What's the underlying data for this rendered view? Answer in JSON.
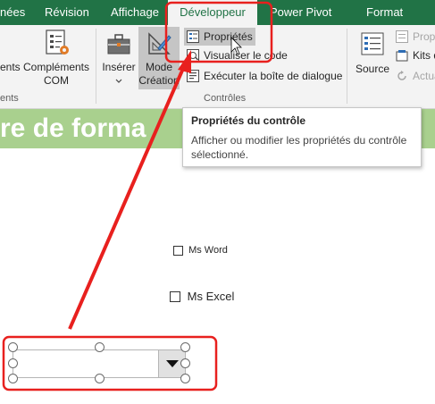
{
  "tabs": [
    {
      "label": "nées"
    },
    {
      "label": "Révision"
    },
    {
      "label": "Affichage"
    },
    {
      "label": "Développeur"
    },
    {
      "label": "Power Pivot"
    },
    {
      "label": "Format"
    }
  ],
  "ribbon": {
    "left_partial_label": "ents",
    "left_group_partial": "ents",
    "complements_com": {
      "line1": "Compléments",
      "line2": "COM"
    },
    "inserer": "Insérer",
    "mode_creation": {
      "line1": "Mode",
      "line2": "Création"
    },
    "proprietes": "Propriétés",
    "visualiser_code": "Visualiser le code",
    "executer_dialogue": "Exécuter la boîte de dialogue",
    "controles_group": "Contrôles",
    "source": "Source",
    "right_items": [
      "Propr",
      "Kits d",
      "Actua"
    ]
  },
  "sheet": {
    "title_partial": "re de forma"
  },
  "tooltip": {
    "title": "Propriétés du contrôle",
    "body": "Afficher ou modifier les propriétés du contrôle sélectionné."
  },
  "checkboxes": [
    {
      "label": "Ms Word"
    },
    {
      "label": "Ms Excel"
    }
  ],
  "colors": {
    "excel_green": "#217346",
    "title_band": "#a9d08e",
    "highlight_red": "#e8201e"
  }
}
